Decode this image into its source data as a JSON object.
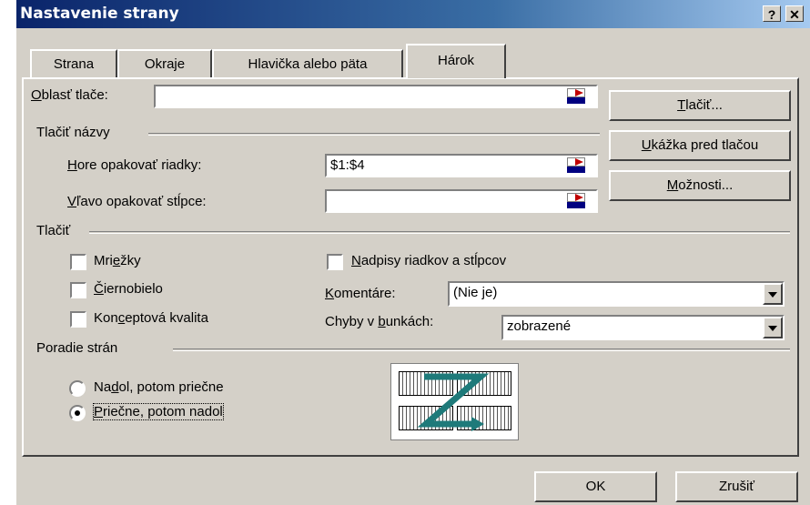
{
  "window": {
    "title": "Nastavenie strany",
    "help_label": "?",
    "close_label": "✕"
  },
  "tabs": [
    {
      "label": "Strana"
    },
    {
      "label": "Okraje"
    },
    {
      "label": "Hlavička alebo päta"
    },
    {
      "label": "Hárok"
    }
  ],
  "print_area": {
    "label_pre": "",
    "label_key": "O",
    "label_post": "blasť tlače:",
    "value": ""
  },
  "print_titles": {
    "group_label": "Tlačiť názvy",
    "rows_label_key": "H",
    "rows_label_post": "ore opakovať riadky:",
    "rows_value": "$1:$4",
    "cols_label_key": "V",
    "cols_label_post": "ľavo opakovať stĺpce:",
    "cols_value": ""
  },
  "print": {
    "group_label": "Tlačiť",
    "gridlines": {
      "pre": "Mri",
      "key": "e",
      "post": "žky",
      "checked": false
    },
    "bw": {
      "pre": "",
      "key": "Č",
      "post": "iernobielo",
      "checked": false
    },
    "draft": {
      "pre": "Kon",
      "key": "c",
      "post": "eptová kvalita",
      "checked": false
    },
    "headings": {
      "pre": "",
      "key": "N",
      "post": "adpisy riadkov a stĺpcov",
      "checked": false
    },
    "comments_label_pre": "",
    "comments_label_key": "K",
    "comments_label_post": "omentáre:",
    "comments_value": "(Nie je)",
    "errors_label_pre": "Chyby v ",
    "errors_label_key": "b",
    "errors_label_post": "unkách:",
    "errors_value": "zobrazené"
  },
  "page_order": {
    "group_label": "Poradie strán",
    "down_pre": "Na",
    "down_key": "d",
    "down_post": "ol, potom priečne",
    "over_pre": "",
    "over_key": "P",
    "over_post": "riečne, potom nadol",
    "selected": "over"
  },
  "buttons": {
    "print_pre": "",
    "print_key": "T",
    "print_post": "lačiť...",
    "preview_pre": "",
    "preview_key": "U",
    "preview_post": "kážka pred tlačou",
    "options_pre": "",
    "options_key": "M",
    "options_post": "ožnosti...",
    "ok": "OK",
    "cancel": "Zrušiť"
  },
  "colors": {
    "face": "#d4d0c8",
    "title_start": "#0a246a",
    "title_end": "#a6caf0",
    "z_arrow": "#1e7a7a"
  }
}
